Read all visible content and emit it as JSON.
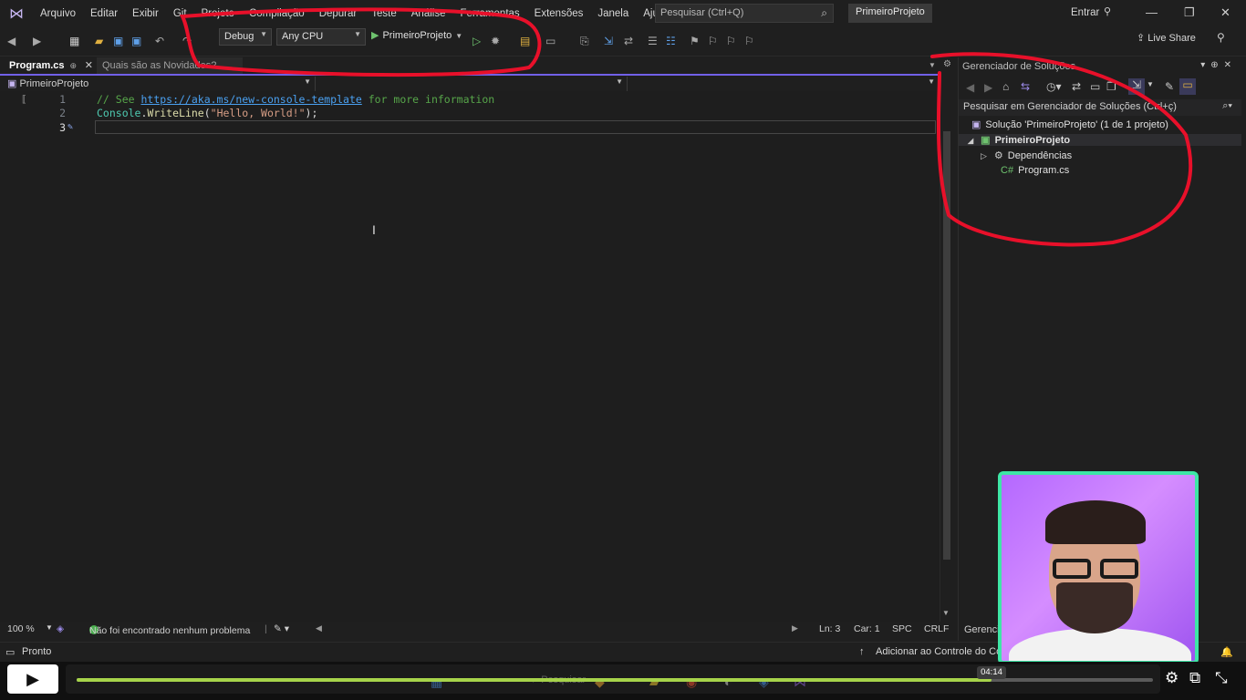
{
  "menu": {
    "items": [
      "Arquivo",
      "Editar",
      "Exibir",
      "Git",
      "Projeto",
      "Compilação",
      "Depurar",
      "Teste",
      "Análise",
      "Ferramentas",
      "Extensões",
      "Janela",
      "Ajuda"
    ],
    "search_placeholder": "Pesquisar (Ctrl+Q)",
    "project_badge": "PrimeiroProjeto",
    "signin": "Entrar"
  },
  "toolbar": {
    "config": "Debug",
    "platform": "Any CPU",
    "run_target": "PrimeiroProjeto",
    "live_share": "Live Share"
  },
  "tabs": {
    "active": "Program.cs",
    "inactive": "Quais são as Novidades?"
  },
  "navbar": {
    "project": "PrimeiroProjeto"
  },
  "editor": {
    "lines": [
      {
        "num": "1",
        "comment_prefix": "// See ",
        "link": "https://aka.ms/new-console-template",
        "comment_suffix": " for more information"
      },
      {
        "num": "2",
        "class": "Console",
        "dot": ".",
        "method": "WriteLine",
        "open": "(",
        "string": "\"Hello, World!\"",
        "close": ");"
      },
      {
        "num": "3"
      }
    ]
  },
  "editor_status": {
    "zoom": "100 %",
    "issues": "Não foi encontrado nenhum problema",
    "line": "Ln: 3",
    "col": "Car: 1",
    "spacing": "SPC",
    "eol": "CRLF"
  },
  "solution_explorer": {
    "title": "Gerenciador de Soluções",
    "search_placeholder": "Pesquisar em Gerenciador de Soluções (Ctrl+ç)",
    "solution": "Solução 'PrimeiroProjeto' (1 de 1 projeto)",
    "project": "PrimeiroProjeto",
    "dependencies": "Dependências",
    "file": "Program.cs",
    "bottom_tab": "Gerenciador de Soluções"
  },
  "statusbar": {
    "ready": "Pronto",
    "source_control": "Adicionar ao Controle do Código-Fonte"
  },
  "player": {
    "time": "04:14",
    "progress": 0.85,
    "taskbar_search": "Pesquisar"
  },
  "colors": {
    "accent": "#7160e8",
    "progress": "#a6d34a",
    "annotation": "#e8102a",
    "webcam_border": "#3ee6a6"
  }
}
